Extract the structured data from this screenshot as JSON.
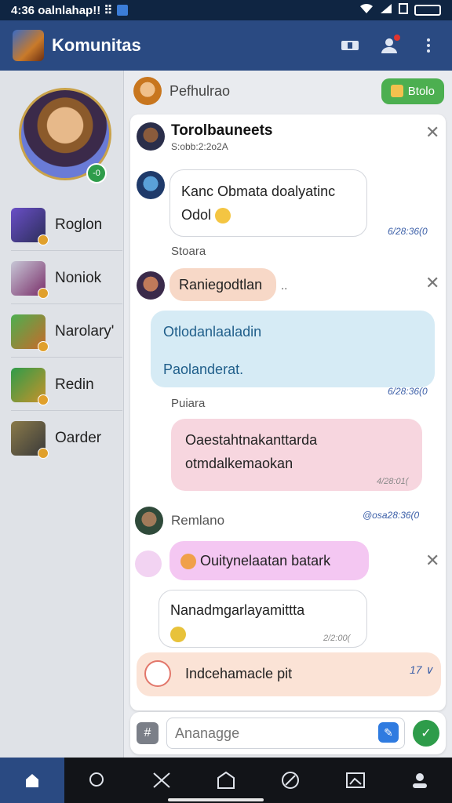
{
  "status_bar": {
    "left_text": "4:36 oalnlahap!! ⠿",
    "battery_text": ""
  },
  "app_bar": {
    "title": "Komunitas"
  },
  "sidebar": {
    "profile_badge": "-0",
    "items": [
      {
        "label": "Roglon"
      },
      {
        "label": "Noniok"
      },
      {
        "label": "Narolary'"
      },
      {
        "label": "Redin"
      },
      {
        "label": "Oarder"
      }
    ]
  },
  "top_row": {
    "name": "Pefhulrao",
    "pill_label": "Btolo"
  },
  "chat": {
    "header_title": "Torolbauneets",
    "header_sub": "S:obb:2:2o2A",
    "msg1": {
      "line1": "Kanc Obmata doalyatinc",
      "line2": "Odol",
      "time": "6/28:36(0"
    },
    "sender1": "Stoara",
    "msg2": {
      "text": "Raniegodtlan",
      "dots": ".."
    },
    "msg3": {
      "line1": "Otlodanlaaladin",
      "line2": "Paolanderat.",
      "time": "6/28:36(0"
    },
    "sender2": "Puiara",
    "msg4": {
      "line1": "Oaestahtnakanttarda",
      "line2": "otmdalkemaokan",
      "time": "4/28:01("
    },
    "msg5": {
      "name": "Remlano",
      "time": "@osa28:36(0"
    },
    "msg6": {
      "text": "Ouitynelaatan batark"
    },
    "msg7": {
      "text": "Nanadmgarlayamittta",
      "time": "2/2:00("
    },
    "msg8": {
      "text": "Indcehamacle pit",
      "badge": "17 ∨"
    }
  },
  "composer": {
    "placeholder": "Ananagge"
  }
}
